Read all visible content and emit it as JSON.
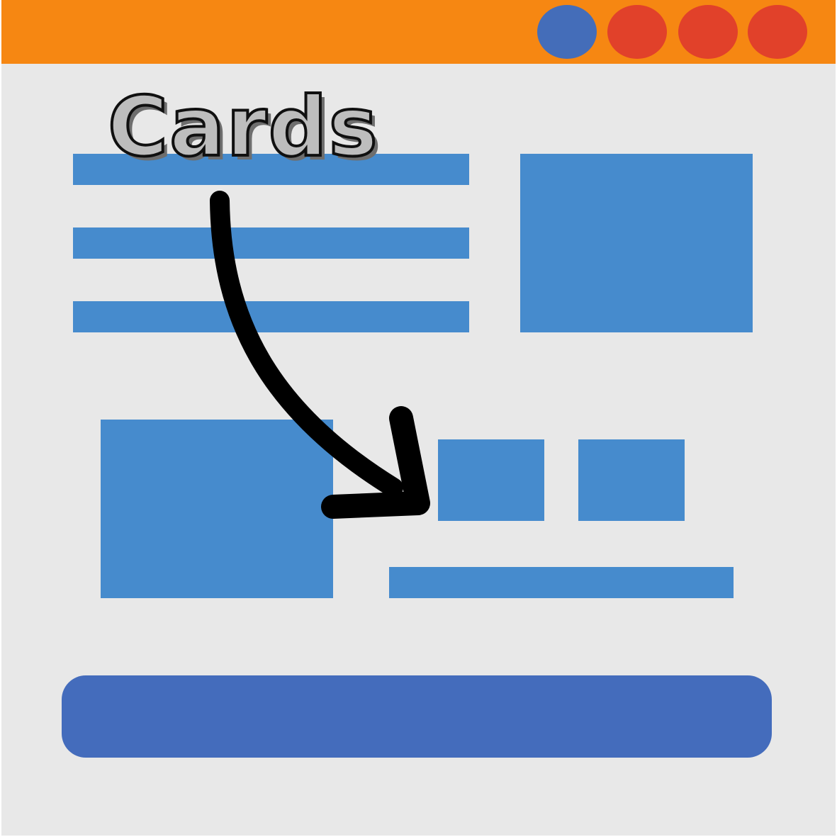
{
  "label": {
    "text": "Cards"
  },
  "colors": {
    "titlebar": "#f68712",
    "background": "#e8e8e8",
    "block": "#468bcd",
    "footer": "#446cbc",
    "dot_blue": "#446db9",
    "dot_red": "#e1412a",
    "arrow": "#000000"
  },
  "icons": {
    "arrow": "curved-arrow-icon"
  }
}
